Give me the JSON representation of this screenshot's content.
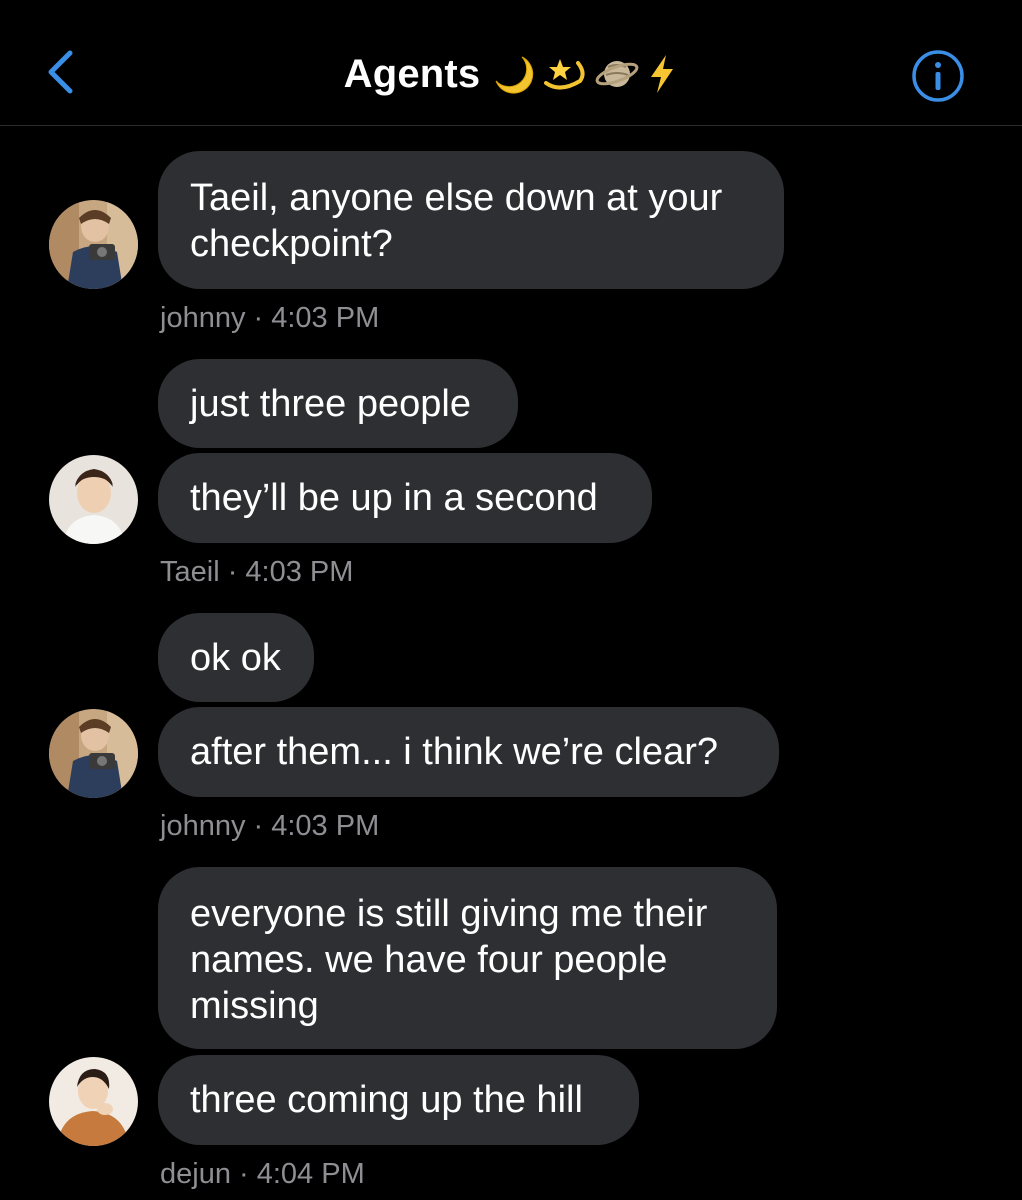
{
  "header": {
    "title": "Agents",
    "emoji_icons": [
      "crescent-moon-icon",
      "dizzy-star-icon",
      "ringed-planet-icon",
      "lightning-bolt-icon"
    ],
    "back_icon": "chevron-left-icon",
    "info_icon": "info-circle-icon"
  },
  "colors": {
    "background": "#000000",
    "bubble": "#2e2f33",
    "accent": "#3a8ee6",
    "meta_text": "#8e8e93",
    "divider": "#2c2c2e"
  },
  "groups": [
    {
      "sender": "johnny",
      "time": "4:03 PM",
      "meta": "johnny · 4:03 PM",
      "messages": [
        "Taeil, anyone else down at your checkpoint?"
      ]
    },
    {
      "sender": "Taeil",
      "time": "4:03 PM",
      "meta": "Taeil · 4:03 PM",
      "messages": [
        "just three people",
        "they’ll be up in a second"
      ]
    },
    {
      "sender": "johnny",
      "time": "4:03 PM",
      "meta": "johnny · 4:03 PM",
      "messages": [
        "ok ok",
        "after them... i think we’re clear?"
      ]
    },
    {
      "sender": "dejun",
      "time": "4:04 PM",
      "meta": "dejun · 4:04 PM",
      "messages": [
        "everyone is still giving me their names. we have four people missing",
        "three coming up the hill"
      ]
    }
  ]
}
